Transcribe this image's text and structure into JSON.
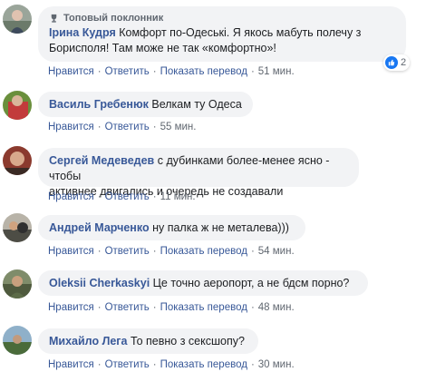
{
  "actions": {
    "like": "Нравится",
    "reply": "Ответить",
    "translate": "Показать перевод",
    "dot": "·"
  },
  "colors": {
    "link": "#385898",
    "bubble": "#f2f3f5",
    "like": "#1877f2"
  },
  "comments": [
    {
      "badge": "Топовый поклонник",
      "author": "Ірина Кудря",
      "line1": "Комфорт по-Одеські. Я якось мабуть полечу з",
      "line2": "Борисполя! Там може не так «комфортно»!",
      "time": "51 мин.",
      "reactions": "2"
    },
    {
      "author": "Василь Гребенюк",
      "text": "Велкам ту Одеса",
      "time": "55 мин."
    },
    {
      "author": "Сергей Медеведев",
      "line1": "с дубинками более-менее ясно - чтобы",
      "line2": "активнее двигались и очередь не создавали",
      "time": "11 мин."
    },
    {
      "author": "Андрей Марченко",
      "text": "ну палка ж не металева)))",
      "time": "54 мин."
    },
    {
      "author": "Oleksii Cherkaskyi",
      "text": "Це точно аеропорт, а не бдсм порно?",
      "time": "48 мин."
    },
    {
      "author": "Михайло Лега",
      "text": "То певно з сексшопу?",
      "time": "30 мин."
    }
  ]
}
